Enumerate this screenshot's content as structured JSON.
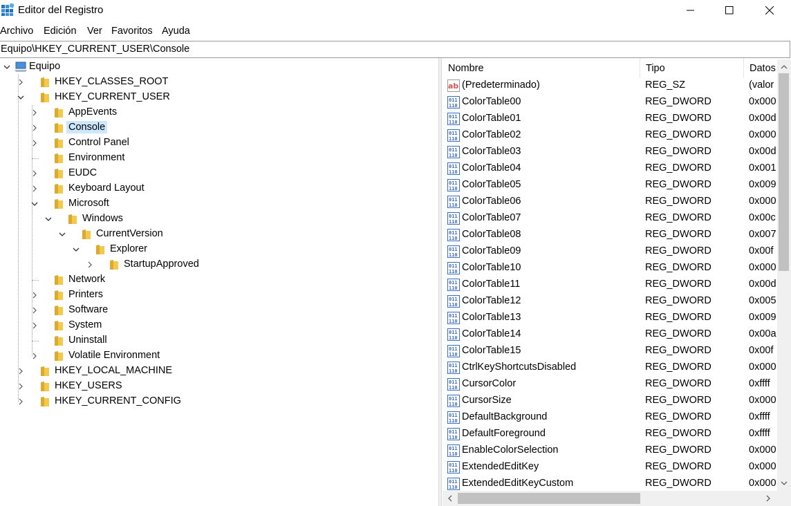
{
  "window": {
    "title": "Editor del Registro"
  },
  "menu": [
    "Archivo",
    "Edición",
    "Ver",
    "Favoritos",
    "Ayuda"
  ],
  "address": "Equipo\\HKEY_CURRENT_USER\\Console",
  "tree": [
    {
      "label": "Equipo",
      "depth": 0,
      "expander": "expanded",
      "icon": "computer-icon"
    },
    {
      "label": "HKEY_CLASSES_ROOT",
      "depth": 1,
      "expander": "collapsed"
    },
    {
      "label": "HKEY_CURRENT_USER",
      "depth": 1,
      "expander": "expanded"
    },
    {
      "label": "AppEvents",
      "depth": 2,
      "expander": "collapsed"
    },
    {
      "label": "Console",
      "depth": 2,
      "expander": "collapsed",
      "selected": true
    },
    {
      "label": "Control Panel",
      "depth": 2,
      "expander": "collapsed"
    },
    {
      "label": "Environment",
      "depth": 2,
      "expander": "none"
    },
    {
      "label": "EUDC",
      "depth": 2,
      "expander": "collapsed"
    },
    {
      "label": "Keyboard Layout",
      "depth": 2,
      "expander": "collapsed"
    },
    {
      "label": "Microsoft",
      "depth": 2,
      "expander": "expanded"
    },
    {
      "label": "Windows",
      "depth": 3,
      "expander": "expanded"
    },
    {
      "label": "CurrentVersion",
      "depth": 4,
      "expander": "expanded"
    },
    {
      "label": "Explorer",
      "depth": 5,
      "expander": "expanded"
    },
    {
      "label": "StartupApproved",
      "depth": 6,
      "expander": "collapsed"
    },
    {
      "label": "Network",
      "depth": 2,
      "expander": "none"
    },
    {
      "label": "Printers",
      "depth": 2,
      "expander": "collapsed"
    },
    {
      "label": "Software",
      "depth": 2,
      "expander": "collapsed"
    },
    {
      "label": "System",
      "depth": 2,
      "expander": "collapsed"
    },
    {
      "label": "Uninstall",
      "depth": 2,
      "expander": "none"
    },
    {
      "label": "Volatile Environment",
      "depth": 2,
      "expander": "collapsed"
    },
    {
      "label": "HKEY_LOCAL_MACHINE",
      "depth": 1,
      "expander": "collapsed"
    },
    {
      "label": "HKEY_USERS",
      "depth": 1,
      "expander": "collapsed"
    },
    {
      "label": "HKEY_CURRENT_CONFIG",
      "depth": 1,
      "expander": "collapsed"
    }
  ],
  "columns": {
    "name": "Nombre",
    "type": "Tipo",
    "data": "Datos"
  },
  "values": [
    {
      "name": "(Predeterminado)",
      "type": "REG_SZ",
      "data": "(valor",
      "icon": "string-value-icon"
    },
    {
      "name": "ColorTable00",
      "type": "REG_DWORD",
      "data": "0x000",
      "icon": "binary-value-icon"
    },
    {
      "name": "ColorTable01",
      "type": "REG_DWORD",
      "data": "0x00d",
      "icon": "binary-value-icon"
    },
    {
      "name": "ColorTable02",
      "type": "REG_DWORD",
      "data": "0x000",
      "icon": "binary-value-icon"
    },
    {
      "name": "ColorTable03",
      "type": "REG_DWORD",
      "data": "0x00d",
      "icon": "binary-value-icon"
    },
    {
      "name": "ColorTable04",
      "type": "REG_DWORD",
      "data": "0x001",
      "icon": "binary-value-icon"
    },
    {
      "name": "ColorTable05",
      "type": "REG_DWORD",
      "data": "0x009",
      "icon": "binary-value-icon"
    },
    {
      "name": "ColorTable06",
      "type": "REG_DWORD",
      "data": "0x000",
      "icon": "binary-value-icon"
    },
    {
      "name": "ColorTable07",
      "type": "REG_DWORD",
      "data": "0x00c",
      "icon": "binary-value-icon"
    },
    {
      "name": "ColorTable08",
      "type": "REG_DWORD",
      "data": "0x007",
      "icon": "binary-value-icon"
    },
    {
      "name": "ColorTable09",
      "type": "REG_DWORD",
      "data": "0x00f",
      "icon": "binary-value-icon"
    },
    {
      "name": "ColorTable10",
      "type": "REG_DWORD",
      "data": "0x000",
      "icon": "binary-value-icon"
    },
    {
      "name": "ColorTable11",
      "type": "REG_DWORD",
      "data": "0x00d",
      "icon": "binary-value-icon"
    },
    {
      "name": "ColorTable12",
      "type": "REG_DWORD",
      "data": "0x005",
      "icon": "binary-value-icon"
    },
    {
      "name": "ColorTable13",
      "type": "REG_DWORD",
      "data": "0x009",
      "icon": "binary-value-icon"
    },
    {
      "name": "ColorTable14",
      "type": "REG_DWORD",
      "data": "0x00a",
      "icon": "binary-value-icon"
    },
    {
      "name": "ColorTable15",
      "type": "REG_DWORD",
      "data": "0x00f",
      "icon": "binary-value-icon"
    },
    {
      "name": "CtrlKeyShortcutsDisabled",
      "type": "REG_DWORD",
      "data": "0x000",
      "icon": "binary-value-icon"
    },
    {
      "name": "CursorColor",
      "type": "REG_DWORD",
      "data": "0xffff",
      "icon": "binary-value-icon"
    },
    {
      "name": "CursorSize",
      "type": "REG_DWORD",
      "data": "0x000",
      "icon": "binary-value-icon"
    },
    {
      "name": "DefaultBackground",
      "type": "REG_DWORD",
      "data": "0xffff",
      "icon": "binary-value-icon"
    },
    {
      "name": "DefaultForeground",
      "type": "REG_DWORD",
      "data": "0xffff",
      "icon": "binary-value-icon"
    },
    {
      "name": "EnableColorSelection",
      "type": "REG_DWORD",
      "data": "0x000",
      "icon": "binary-value-icon"
    },
    {
      "name": "ExtendedEditKey",
      "type": "REG_DWORD",
      "data": "0x000",
      "icon": "binary-value-icon"
    },
    {
      "name": "ExtendedEditKeyCustom",
      "type": "REG_DWORD",
      "data": "0x000",
      "icon": "binary-value-icon"
    }
  ],
  "colors": {
    "selection": "#cce8ff",
    "folder": "#f2c94c",
    "folder_dark": "#dcaa2c",
    "binary_icon": "#3a6fc4",
    "string_icon": "#d9534f"
  }
}
